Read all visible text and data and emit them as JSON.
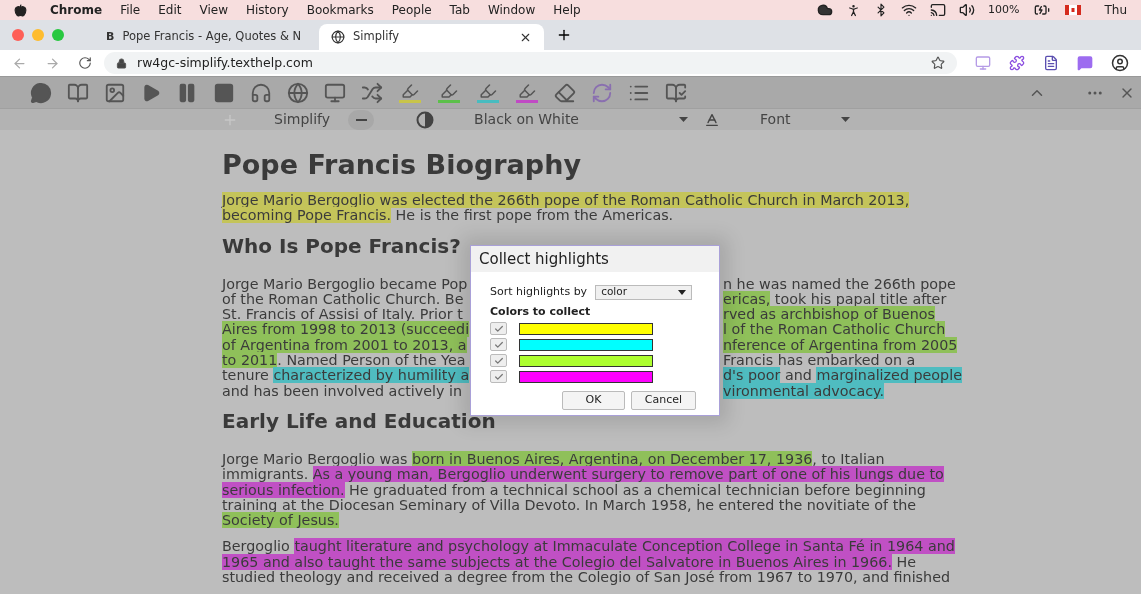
{
  "menu_bar": {
    "app": "Chrome",
    "items": [
      "File",
      "Edit",
      "View",
      "History",
      "Bookmarks",
      "People",
      "Tab",
      "Window",
      "Help"
    ],
    "battery": "100%",
    "clock": "Thu"
  },
  "tabs": [
    {
      "favicon": "B",
      "title": "Pope Francis - Age, Quotes & N",
      "selected": false
    },
    {
      "title": "Simplify",
      "selected": true
    }
  ],
  "address_bar": {
    "url": "rw4gc-simplify.texthelp.com"
  },
  "toolbar": {
    "highlighters": [
      {
        "color": "#c8c44a"
      },
      {
        "color": "#5cc04a"
      },
      {
        "color": "#48bcc0"
      },
      {
        "color": "#c04ac4"
      }
    ]
  },
  "toolbar2": {
    "simplify": "Simplify",
    "color_scheme": "Black on White",
    "font": "Font"
  },
  "document": {
    "title": "Pope Francis Biography",
    "blocks": [
      {
        "kind": "paragraph",
        "lines": [
          [
            {
              "text": "Jorge Mario Bergoglio was elected the 266th pope of the Roman Catholic Church in March 2013,",
              "color": "#c4c45a"
            }
          ],
          [
            {
              "text": "becoming Pope Francis.",
              "color": "#c4c45a"
            },
            {
              "text": " He is the first pope from the Americas."
            }
          ]
        ]
      },
      {
        "kind": "heading",
        "text": "Who Is Pope Francis?"
      },
      {
        "kind": "covered_paragraph",
        "lines": [
          {
            "left": [
              {
                "text": "Jorge Mario Bergoglio became Pop"
              }
            ],
            "right": [
              {
                "text": "n he was named the 266th pope"
              }
            ]
          },
          {
            "left": [
              {
                "text": "of the Roman Catholic Church. Be"
              }
            ],
            "right": [
              {
                "text": "ericas,",
                "color": "#8fc05a"
              },
              {
                "text": " took his papal title after"
              }
            ]
          },
          {
            "left": [
              {
                "text": "St. Francis of Assisi of Italy. Prior t"
              }
            ],
            "right": [
              {
                "text": "rved as archbishop of Buenos",
                "color": "#8fc05a"
              }
            ]
          },
          {
            "left": [
              {
                "text": "Aires from 1998 to 2013 (succeedi",
                "color": "#8fc05a"
              }
            ],
            "right": [
              {
                "text": "l of the Roman Catholic Church",
                "color": "#8fc05a"
              }
            ]
          },
          {
            "left": [
              {
                "text": "of Argentina from 2001 to 2013, a",
                "color": "#8fc05a"
              }
            ],
            "right": [
              {
                "text": "nference of Argentina from 2005",
                "color": "#8fc05a"
              }
            ]
          },
          {
            "left": [
              {
                "text": "to 2011",
                "color": "#8fc05a"
              },
              {
                "text": ". Named Person of the Yea"
              }
            ],
            "right": [
              {
                "text": "Francis has embarked on a"
              }
            ]
          },
          {
            "left": [
              {
                "text": "tenure "
              },
              {
                "text": "characterized by humility a",
                "color": "#4fbcc0"
              }
            ],
            "right": [
              {
                "text": "d's poor",
                "color": "#4fbcc0"
              },
              {
                "text": " and "
              },
              {
                "text": "marginalized people",
                "color": "#4fbcc0"
              }
            ]
          },
          {
            "left": [
              {
                "text": "and has been involved actively in"
              }
            ],
            "right": [
              {
                "text": "vironmental advocacy.",
                "color": "#4fbcc0"
              }
            ]
          }
        ]
      },
      {
        "kind": "heading",
        "text": "Early Life and Education"
      },
      {
        "kind": "paragraph",
        "lines": [
          [
            {
              "text": "Jorge Mario Bergoglio was "
            },
            {
              "text": "born in Buenos Aires, Argentina, on December 17, 1936",
              "color": "#8fc05a"
            },
            {
              "text": ", to Italian"
            }
          ],
          [
            {
              "text": "immigrants. "
            },
            {
              "text": "As a young man, Bergoglio underwent surgery to remove part of one of his lungs due to",
              "color": "#c050c4"
            }
          ],
          [
            {
              "text": "serious infection.",
              "color": "#c050c4"
            },
            {
              "text": " He graduated from a technical school as a chemical technician before beginning"
            }
          ],
          [
            {
              "text": "training at the Diocesan Seminary of Villa Devoto. In March 1958, he entered the novitiate of the"
            }
          ],
          [
            {
              "text": "Society of Jesus.",
              "color": "#8fc05a"
            }
          ]
        ]
      },
      {
        "kind": "paragraph",
        "lines": [
          [
            {
              "text": "Bergoglio "
            },
            {
              "text": "taught literature and psychology at Immaculate Conception College in Santa Fé in 1964 and",
              "color": "#c050c4"
            }
          ],
          [
            {
              "text": "1965 and also taught the same subjects at the Colegio del Salvatore in Buenos Aires in 1966.",
              "color": "#c050c4"
            },
            {
              "text": " He"
            }
          ],
          [
            {
              "text": "studied theology and received a degree from the Colegio of San José from 1967 to 1970, and finished"
            }
          ]
        ]
      }
    ]
  },
  "dialog": {
    "title": "Collect highlights",
    "sort_label": "Sort highlights by",
    "sort_value": "color",
    "colors_label": "Colors to collect",
    "colors": [
      {
        "color": "#ffff00",
        "checked": true
      },
      {
        "color": "#00ffff",
        "checked": true
      },
      {
        "color": "#adff2f",
        "checked": true
      },
      {
        "color": "#ff00ff",
        "checked": true
      }
    ],
    "buttons": [
      "OK",
      "Cancel"
    ]
  }
}
